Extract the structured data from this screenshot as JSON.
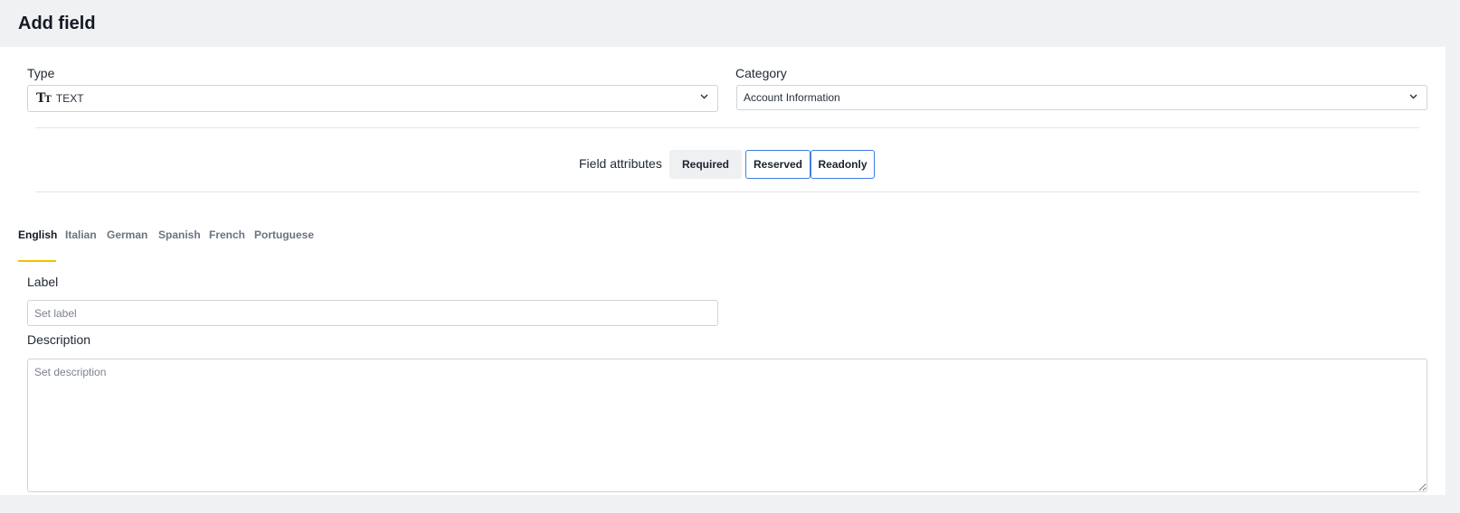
{
  "header": {
    "title": "Add field"
  },
  "form": {
    "type": {
      "label": "Type",
      "value": "TEXT",
      "icon": "text-type-icon"
    },
    "category": {
      "label": "Category",
      "value": "Account Information"
    },
    "attributes": {
      "title": "Field attributes",
      "buttons": [
        {
          "label": "Required",
          "selected": false
        },
        {
          "label": "Reserved",
          "selected": true
        },
        {
          "label": "Readonly",
          "selected": true
        }
      ]
    },
    "languages": {
      "tabs": [
        {
          "label": "English",
          "active": true
        },
        {
          "label": "Italian",
          "active": false
        },
        {
          "label": "German",
          "active": false
        },
        {
          "label": "Spanish",
          "active": false
        },
        {
          "label": "French",
          "active": false
        },
        {
          "label": "Portuguese",
          "active": false
        }
      ]
    },
    "label_field": {
      "label": "Label",
      "placeholder": "Set label",
      "value": ""
    },
    "description_field": {
      "label": "Description",
      "placeholder": "Set description",
      "value": ""
    }
  },
  "colors": {
    "active_tab_underline": "#f2c100",
    "selected_attribute_border": "#3d7ee0",
    "header_background": "#f0f1f3"
  }
}
